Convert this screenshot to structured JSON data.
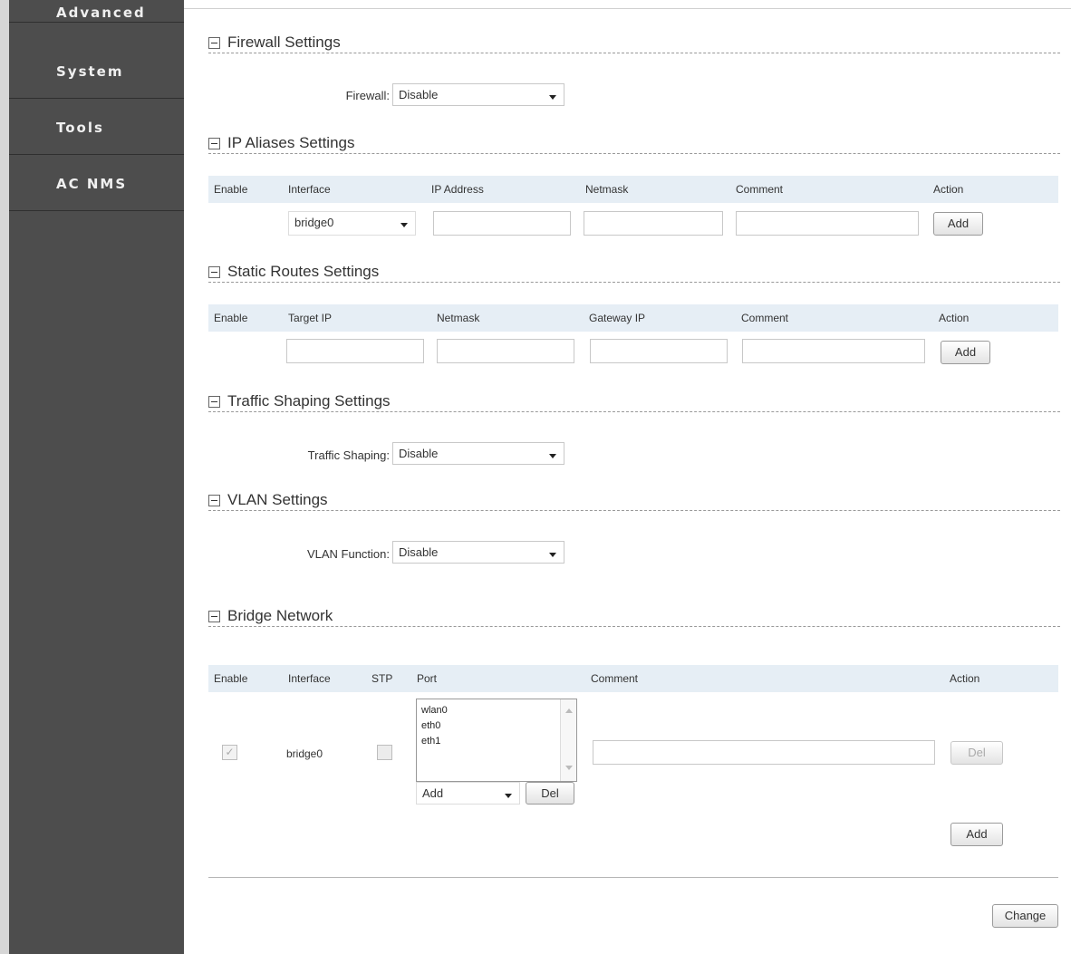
{
  "sidebar": {
    "items": [
      {
        "label": "Advanced"
      },
      {
        "label": "System"
      },
      {
        "label": "Tools"
      },
      {
        "label": "AC NMS"
      }
    ]
  },
  "firewall": {
    "title": "Firewall Settings",
    "label": "Firewall:",
    "value": "Disable"
  },
  "ip_aliases": {
    "title": "IP Aliases Settings",
    "columns": [
      "Enable",
      "Interface",
      "IP Address",
      "Netmask",
      "Comment",
      "Action"
    ],
    "interface_value": "bridge0",
    "add_label": "Add"
  },
  "static_routes": {
    "title": "Static Routes Settings",
    "columns": [
      "Enable",
      "Target IP",
      "Netmask",
      "Gateway IP",
      "Comment",
      "Action"
    ],
    "add_label": "Add"
  },
  "traffic": {
    "title": "Traffic Shaping Settings",
    "label": "Traffic Shaping:",
    "value": "Disable"
  },
  "vlan": {
    "title": "VLAN Settings",
    "label": "VLAN Function:",
    "value": "Disable"
  },
  "bridge": {
    "title": "Bridge Network",
    "columns": [
      "Enable",
      "Interface",
      "STP",
      "Port",
      "Comment",
      "Action"
    ],
    "row": {
      "enable_mark": "✓",
      "interface": "bridge0",
      "ports": [
        "wlan0",
        "eth0",
        "eth1"
      ],
      "port_add_value": "Add",
      "port_del_label": "Del",
      "del_label": "Del"
    },
    "add_label": "Add"
  },
  "footer": {
    "change_label": "Change"
  }
}
